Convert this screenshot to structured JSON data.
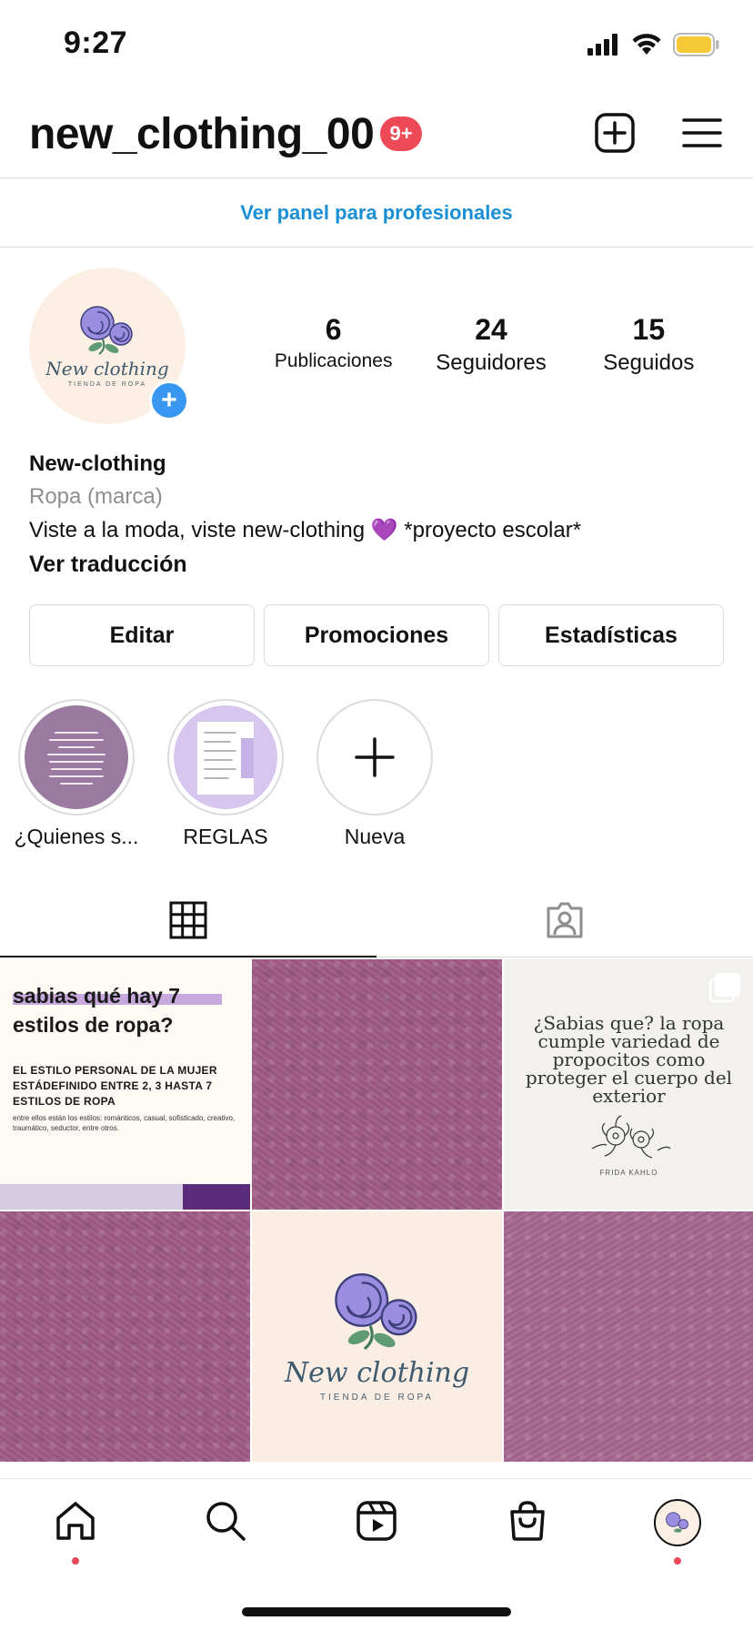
{
  "status_bar": {
    "time": "9:27"
  },
  "header": {
    "username": "new_clothing_00",
    "notification_badge": "9+"
  },
  "pro_panel": {
    "label": "Ver panel para profesionales"
  },
  "profile": {
    "stats": [
      {
        "value": "6",
        "label": "Publicaciones"
      },
      {
        "value": "24",
        "label": "Seguidores"
      },
      {
        "value": "15",
        "label": "Seguidos"
      }
    ],
    "avatar_brand": "New clothing",
    "avatar_sub": "TIENDA DE ROPA",
    "name": "New-clothing",
    "category": "Ropa (marca)",
    "bio": "Viste a la moda, viste new-clothing 💜 *proyecto escolar*",
    "translate": "Ver traducción"
  },
  "actions": {
    "edit": "Editar",
    "promotions": "Promociones",
    "statistics": "Estadísticas"
  },
  "highlights": [
    {
      "label": "¿Quienes s..."
    },
    {
      "label": "REGLAS"
    },
    {
      "label": "Nueva"
    }
  ],
  "posts": {
    "p1": {
      "title_line1": "sabias qué hay 7",
      "title_line2": "estilos de ropa?",
      "subtitle": "EL ESTILO PERSONAL DE LA MUJER ESTÁDEFINIDO ENTRE 2, 3 HASTA 7 ESTILOS DE ROPA",
      "small": "entre ellos están los estilos: románticos, casual, sofisticado, creativo, traumático, seductor, entre otros."
    },
    "p3": {
      "text": "¿Sabias que? la ropa cumple variedad de propocitos como proteger el cuerpo del exterior",
      "signature": "FRIDA KAHLO"
    },
    "p5": {
      "brand": "New clothing",
      "sub": "TIENDA DE ROPA"
    }
  },
  "colors": {
    "accent_blue": "#1a8fd6",
    "badge_red": "#ed4956",
    "plum": "#9e5a86"
  }
}
